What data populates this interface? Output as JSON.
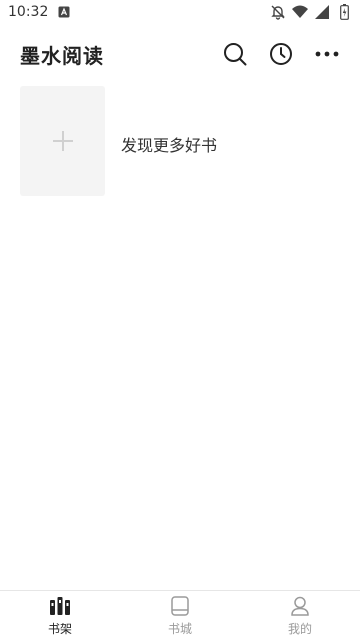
{
  "status_bar": {
    "time": "10:32",
    "icons": [
      "notification-a-icon",
      "bell-off-icon",
      "wifi-icon",
      "signal-icon",
      "battery-icon"
    ]
  },
  "app_bar": {
    "title": "墨水阅读",
    "actions": [
      "search-icon",
      "history-clock-icon",
      "more-dots-icon"
    ]
  },
  "bookshelf": {
    "add_card_icon": "plus-icon",
    "add_label": "发现更多好书"
  },
  "bottom_nav": {
    "active": "书架",
    "items": [
      {
        "label": "书架",
        "icon": "bookshelf-icon"
      },
      {
        "label": "书城",
        "icon": "book-store-icon"
      },
      {
        "label": "我的",
        "icon": "profile-icon"
      }
    ]
  },
  "colors": {
    "active_text": "#222222",
    "inactive_text": "#9a9a9a",
    "card_bg": "#f4f4f4"
  }
}
